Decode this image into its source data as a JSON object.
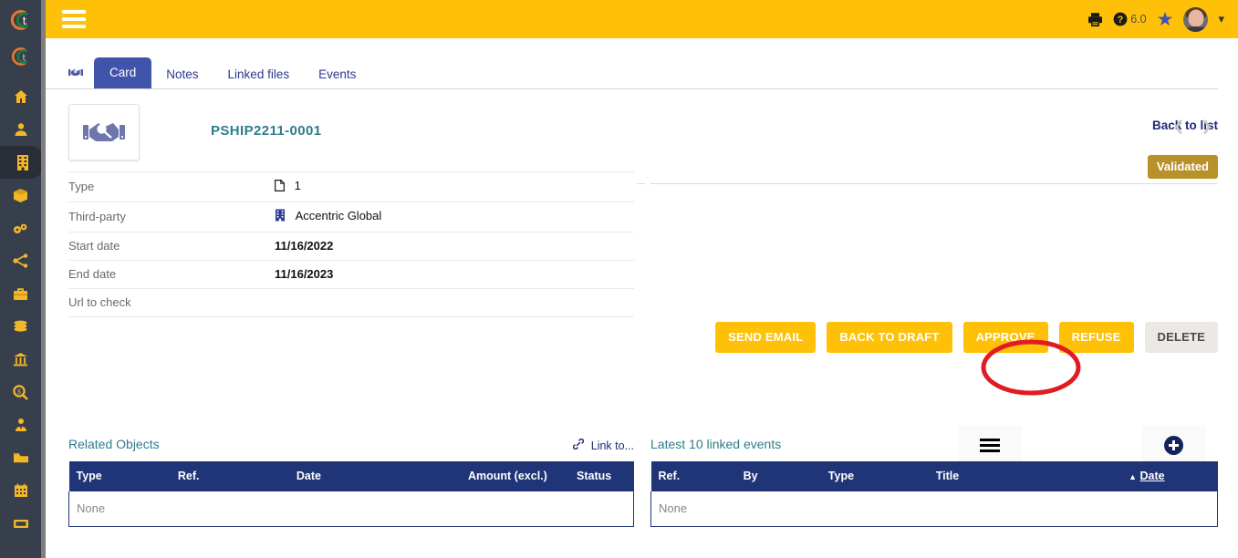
{
  "colors": {
    "topbar": "#ffc107",
    "sidebar": "#373e4c",
    "sidebar_icon": "#f4b728",
    "accent_navy": "#1f3577",
    "title_teal": "#2e7d8c",
    "badge_gold": "#b9912b",
    "annotation_red": "#e01b24",
    "tab_active": "#4154ab"
  },
  "topbar": {
    "menu_icon": "hamburger-icon",
    "print_icon": "printer-icon",
    "help_icon": "help-circle-icon",
    "version": "6.0",
    "bookmark_icon": "star-icon",
    "avatar": "user-avatar",
    "user_chevron": "chevron-down-icon"
  },
  "sidebar": {
    "logo_primary": "app-logo",
    "logo_secondary": "app-logo-small",
    "items": [
      {
        "name": "home",
        "icon": "🏠",
        "active": false
      },
      {
        "name": "members",
        "icon": "👤",
        "active": false
      },
      {
        "name": "third-parties",
        "icon": "🏢",
        "active": true
      },
      {
        "name": "products",
        "icon": "📦",
        "active": false
      },
      {
        "name": "stock",
        "icon": "⚙",
        "active": false
      },
      {
        "name": "projects",
        "icon": "⚯",
        "active": false
      },
      {
        "name": "commercial",
        "icon": "💼",
        "active": false
      },
      {
        "name": "billing",
        "icon": "💰",
        "active": false
      },
      {
        "name": "accounting",
        "icon": "🏦",
        "active": false
      },
      {
        "name": "audit",
        "icon": "🔍",
        "active": false
      },
      {
        "name": "hrm",
        "icon": "👔",
        "active": false
      },
      {
        "name": "documents",
        "icon": "📂",
        "active": false
      },
      {
        "name": "agenda",
        "icon": "📅",
        "active": false
      },
      {
        "name": "tickets",
        "icon": "🎫",
        "active": false
      }
    ]
  },
  "tabs": {
    "leading_icon": "handshake-icon",
    "items": [
      {
        "label": "Card",
        "active": true
      },
      {
        "label": "Notes",
        "active": false
      },
      {
        "label": "Linked files",
        "active": false
      },
      {
        "label": "Events",
        "active": false
      }
    ]
  },
  "card": {
    "object_icon": "handshake-icon",
    "reference": "PSHIP2211-0001",
    "back_to_list": "Back to list",
    "prev_icon": "chevron-left-icon",
    "next_icon": "chevron-right-icon",
    "status_badge": "Validated"
  },
  "fields": [
    {
      "label": "Type",
      "value": "1",
      "icon": "document-icon"
    },
    {
      "label": "Third-party",
      "value": "Accentric Global",
      "icon": "building-icon"
    },
    {
      "label": "Start date",
      "value": "11/16/2022",
      "icon": ""
    },
    {
      "label": "End date",
      "value": "11/16/2023",
      "icon": ""
    },
    {
      "label": "Url to check",
      "value": "",
      "icon": ""
    }
  ],
  "actions": [
    {
      "label": "SEND EMAIL",
      "style": "primary"
    },
    {
      "label": "BACK TO DRAFT",
      "style": "primary"
    },
    {
      "label": "APPROVE",
      "style": "primary",
      "highlighted": true
    },
    {
      "label": "REFUSE",
      "style": "primary"
    },
    {
      "label": "DELETE",
      "style": "grey"
    }
  ],
  "related_objects": {
    "title": "Related Objects",
    "link_label": "Link to...",
    "link_icon": "chain-link-icon",
    "columns": [
      "Type",
      "Ref.",
      "Date",
      "Amount (excl.)",
      "Status"
    ],
    "empty_text": "None"
  },
  "linked_events": {
    "title": "Latest 10 linked events",
    "menu_icon": "hamburger-icon",
    "add_icon": "plus-circle-icon",
    "columns": [
      "Ref.",
      "By",
      "Type",
      "Title",
      "Date"
    ],
    "sort_column": "Date",
    "sort_direction": "asc",
    "sort_icon": "triangle-up-icon",
    "empty_text": "None"
  }
}
